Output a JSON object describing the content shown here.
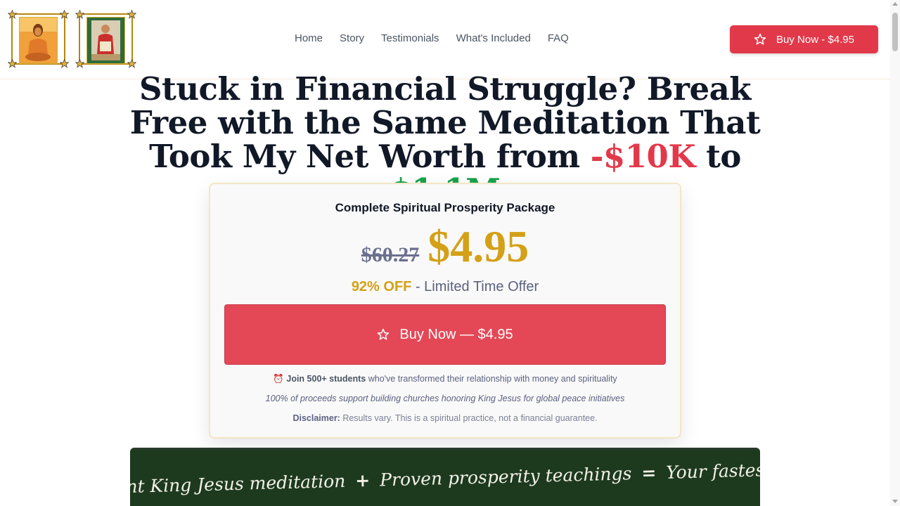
{
  "header": {
    "logo1_alt": "meditating master portrait",
    "logo2_alt": "king jesus portrait",
    "nav": [
      "Home",
      "Story",
      "Testimonials",
      "What's Included",
      "FAQ"
    ],
    "buy_button": "Buy Now - $4.95"
  },
  "hero": {
    "headline_part1": "Stuck in Financial Struggle? Break Free with the Same Meditation That Took My Net Worth from ",
    "neg_value": "-$10K",
    "connector": " to ",
    "pos_value": "$1.1M"
  },
  "offer": {
    "title": "Complete Spiritual Prosperity Package",
    "old_price": "$60.27",
    "new_price": "$4.95",
    "discount_pct": "92% OFF",
    "discount_text": " - Limited Time Offer",
    "buy_button": "Buy Now — $4.95",
    "students_icon": "⏰",
    "students_bold": "Join 500+ students",
    "students_text": " who've transformed their relationship with money and spirituality",
    "proceeds_text": "100% of proceeds support building churches honoring King Jesus for global peace initiatives",
    "disclaimer_label": "Disclaimer:",
    "disclaimer_text": " Results vary. This is a spiritual practice, not a financial guarantee."
  },
  "chalkboard": {
    "part1": "nt King Jesus meditation",
    "plus": "+",
    "part2": "Proven prosperity teachings",
    "equals": "=",
    "part3": "Your fastest path to abun"
  },
  "colors": {
    "accent_red": "#e2394a",
    "gold": "#d4a017",
    "green": "#16a34a",
    "chalkboard": "#1d3a1f"
  }
}
